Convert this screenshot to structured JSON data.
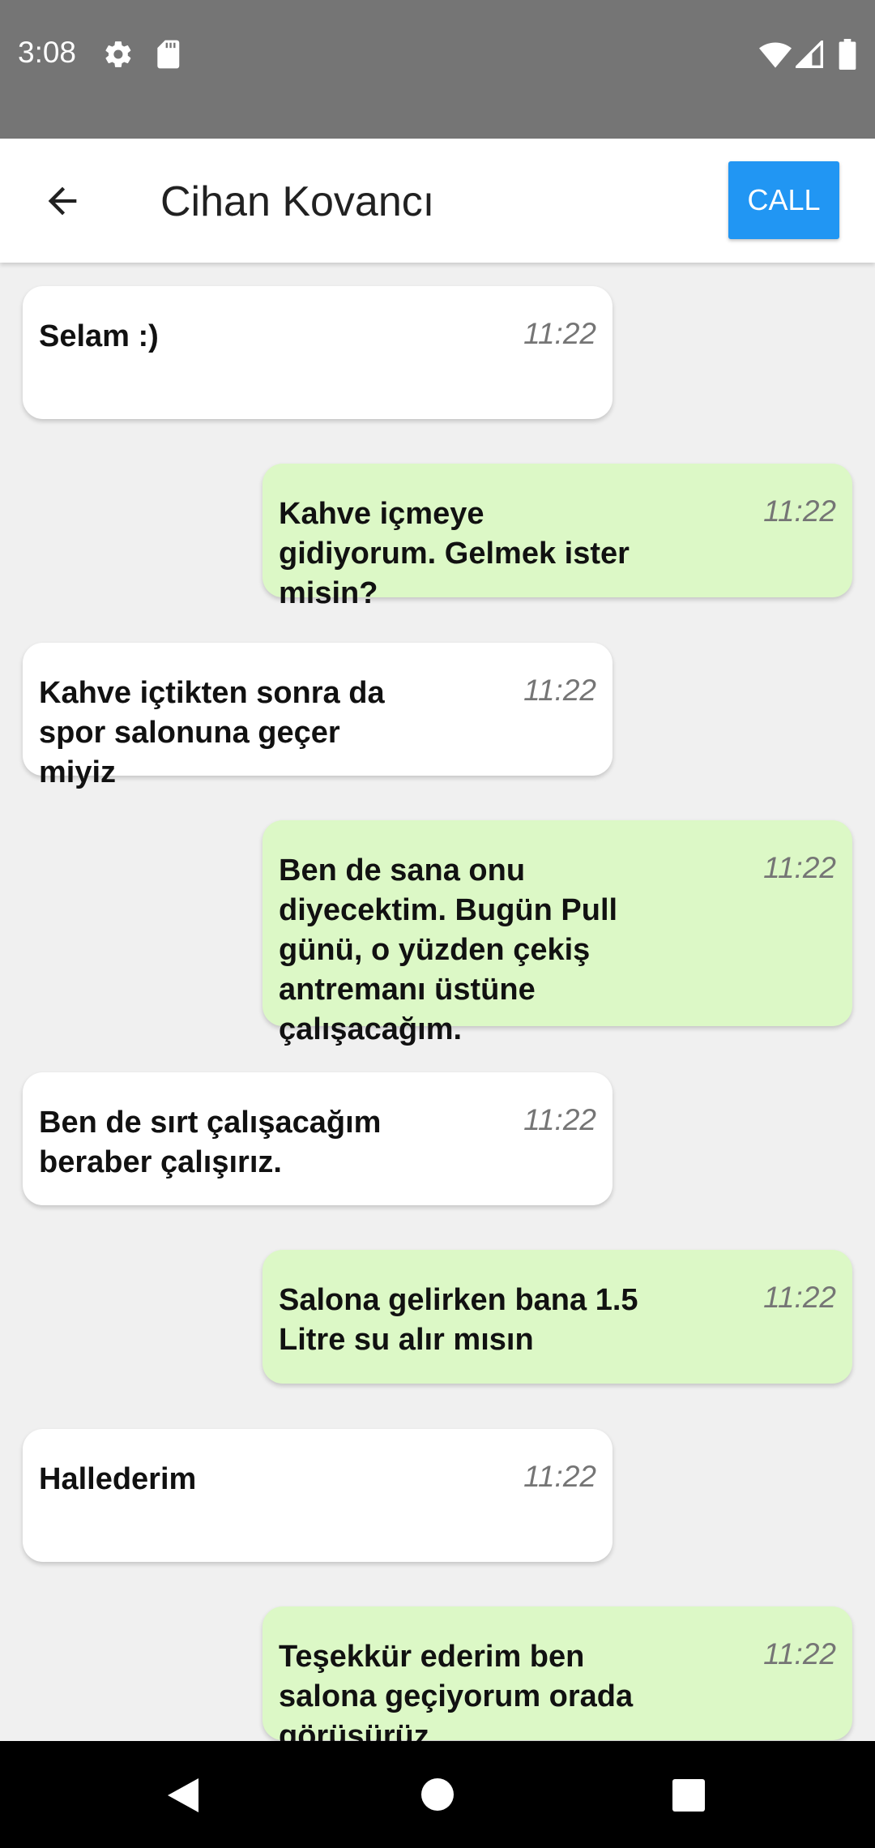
{
  "status_bar": {
    "time": "3:08",
    "icons": [
      "gear-icon",
      "sd-card-icon",
      "wifi-icon",
      "signal-icon",
      "battery-icon"
    ]
  },
  "app_bar": {
    "title": "Cihan Kovancı",
    "call_label": "CALL",
    "accent": "#2196f3"
  },
  "colors": {
    "incoming_bubble": "#ffffff",
    "outgoing_bubble": "#dcf8c6",
    "background": "#f0f0f0"
  },
  "messages": [
    {
      "direction": "incoming",
      "text": "Selam :)",
      "time": "11:22"
    },
    {
      "direction": "outgoing",
      "text": "Kahve içmeye gidiyorum. Gelmek ister misin?",
      "time": "11:22"
    },
    {
      "direction": "incoming",
      "text": "Kahve içtikten sonra da spor salonuna geçer miyiz",
      "time": "11:22"
    },
    {
      "direction": "outgoing",
      "text": "Ben de sana onu diyecektim. Bugün Pull günü, o yüzden çekiş antremanı üstüne çalışacağım.",
      "time": "11:22"
    },
    {
      "direction": "incoming",
      "text": "Ben de sırt çalışacağım beraber çalışırız.",
      "time": "11:22"
    },
    {
      "direction": "outgoing",
      "text": "Salona gelirken bana 1.5 Litre su alır mısın",
      "time": "11:22"
    },
    {
      "direction": "incoming",
      "text": "Hallederim",
      "time": "11:22"
    },
    {
      "direction": "outgoing",
      "text": "Teşekkür ederim ben salona geçiyorum orada görüşürüz.",
      "time": "11:22"
    }
  ],
  "nav_bar": {
    "buttons": [
      "back-triangle-icon",
      "home-circle-icon",
      "recents-square-icon"
    ]
  }
}
